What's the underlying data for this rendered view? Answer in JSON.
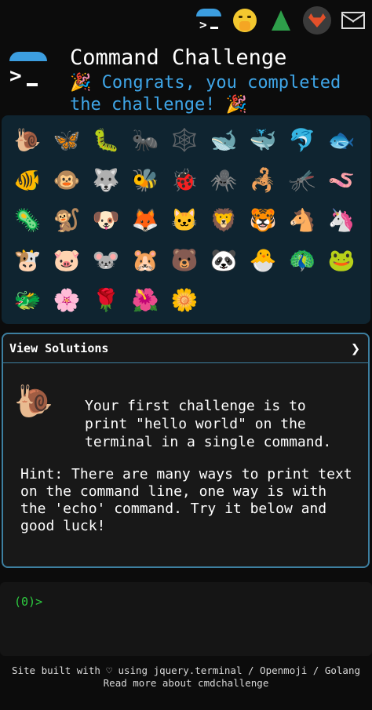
{
  "topbar": {
    "icons": [
      "terminal-logo-icon",
      "shushing-face-icon",
      "evergreen-tree-icon",
      "gitlab-icon",
      "envelope-icon"
    ]
  },
  "header": {
    "title": "Command Challenge",
    "congrats": "🎉 Congrats, you completed the challenge! 🎉"
  },
  "emojis": [
    "🐌",
    "🦋",
    "🐛",
    "🐜",
    "🕸️",
    "🐋",
    "🐳",
    "🐬",
    "🐟",
    "🐠",
    "🐵",
    "🐺",
    "🐝",
    "🐞",
    "🕷️",
    "🦂",
    "🦟",
    "🪱",
    "🦠",
    "🐒",
    "🐶",
    "🦊",
    "🐱",
    "🦁",
    "🐯",
    "🐴",
    "🦄",
    "🐮",
    "🐷",
    "🐭",
    "🐹",
    "🐻",
    "🐼",
    "🐣",
    "🦚",
    "🐸",
    "🐲",
    "🌸",
    "🌹",
    "🌺",
    "🌼"
  ],
  "solutions": {
    "header": "View Solutions",
    "chevron": "❯",
    "icon": "🐌",
    "challenge": "Your first challenge is to print \"hello world\" on the terminal in a single command.",
    "hint": "Hint: There are many ways to print text on the command line, one way is with the 'echo' command. Try it below and good luck!"
  },
  "terminal": {
    "prompt": "(0)>"
  },
  "footer": {
    "line1": "Site built with ♡ using jquery.terminal / Openmoji / Golang",
    "line2": "Read more about cmdchallenge"
  }
}
